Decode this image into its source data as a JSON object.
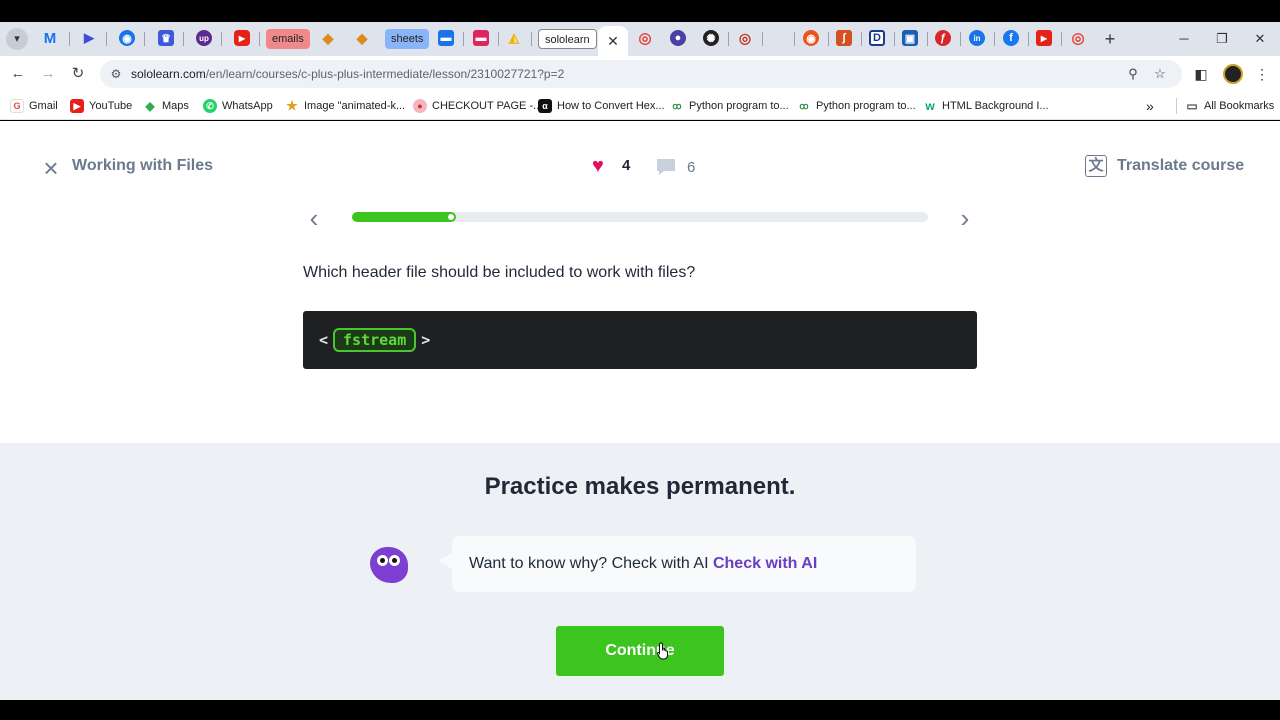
{
  "browser": {
    "tabs": [
      "emails",
      "sheets",
      "sololearn"
    ],
    "address": {
      "host": "sololearn.com",
      "path": "/en/learn/courses/c-plus-plus-intermediate/lesson/2310027721?p=2"
    },
    "bookmarks": [
      {
        "label": "Gmail"
      },
      {
        "label": "YouTube"
      },
      {
        "label": "Maps"
      },
      {
        "label": "WhatsApp"
      },
      {
        "label": "Image \"animated-k..."
      },
      {
        "label": "CHECKOUT PAGE -..."
      },
      {
        "label": "How to Convert Hex..."
      },
      {
        "label": "Python program to..."
      },
      {
        "label": "Python program to..."
      },
      {
        "label": "HTML Background I..."
      }
    ],
    "all_bookmarks": "All Bookmarks",
    "chevron": "»"
  },
  "lesson": {
    "title": "Working with Files",
    "hearts": "4",
    "comments": "6",
    "translate": "Translate course",
    "progress": 0.18,
    "question": "Which header file should be included to work with files?",
    "code": {
      "open": "<",
      "blank": "fstream",
      "close": ">"
    }
  },
  "practice": {
    "title": "Practice makes permanent.",
    "bubble_text": "Want to know why? Check with AI",
    "ai_link": "Check with AI",
    "continue": "Continue"
  },
  "colors": {
    "accent_green": "#3cc51f",
    "heart": "#e0115f",
    "ai_purple": "#6a3fbf"
  }
}
